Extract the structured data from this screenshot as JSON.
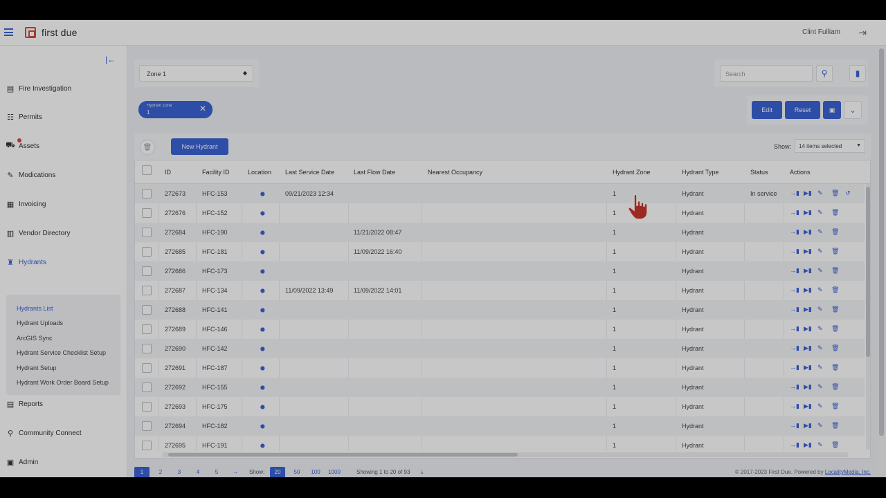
{
  "app": {
    "logo_text": "first due",
    "user_name": "Clint Fulliam"
  },
  "sidebar": {
    "items": [
      {
        "label": "Fire Investigation",
        "icon": "file-icon"
      },
      {
        "label": "Permits",
        "icon": "sliders-icon"
      },
      {
        "label": "Assets",
        "icon": "truck-icon"
      },
      {
        "label": "Modications",
        "icon": "pen-icon"
      },
      {
        "label": "Invoicing",
        "icon": "invoice-icon"
      },
      {
        "label": "Vendor Directory",
        "icon": "book-icon"
      },
      {
        "label": "Hydrants",
        "icon": "hydrant-icon"
      },
      {
        "label": "Reports",
        "icon": "report-icon"
      },
      {
        "label": "Community Connect",
        "icon": "search-icon"
      },
      {
        "label": "Admin",
        "icon": "admin-icon"
      }
    ],
    "subitems": [
      "Hydrants List",
      "Hydrant Uploads",
      "ArcGIS Sync",
      "Hydrant Service Checklist Setup",
      "Hydrant Setup",
      "Hydrant Work Order Board Setup"
    ]
  },
  "filters": {
    "zone_select": "Zone 1",
    "search_placeholder": "Search",
    "chip_label": "Hydrant Zone",
    "chip_value": "1",
    "edit_label": "Edit",
    "reset_label": "Reset"
  },
  "toolbar": {
    "new_button": "New Hydrant",
    "show_label": "Show:",
    "show_value": "14 items selected"
  },
  "table": {
    "columns": [
      "ID",
      "Facility ID",
      "Location",
      "Last Service Date",
      "Last Flow Date",
      "Nearest Occupancy",
      "Hydrant Zone",
      "Hydrant Type",
      "Status",
      "Actions"
    ],
    "rows": [
      {
        "id": "272673",
        "facility": "HFC-153",
        "service": "09/21/2023 12:34",
        "flow": "",
        "zone": "1",
        "type": "Hydrant",
        "status": "In service"
      },
      {
        "id": "272676",
        "facility": "HFC-152",
        "service": "",
        "flow": "",
        "zone": "1",
        "type": "Hydrant",
        "status": ""
      },
      {
        "id": "272684",
        "facility": "HFC-190",
        "service": "",
        "flow": "11/21/2022 08:47",
        "zone": "1",
        "type": "Hydrant",
        "status": ""
      },
      {
        "id": "272685",
        "facility": "HFC-181",
        "service": "",
        "flow": "11/09/2022 16:40",
        "zone": "1",
        "type": "Hydrant",
        "status": ""
      },
      {
        "id": "272686",
        "facility": "HFC-173",
        "service": "",
        "flow": "",
        "zone": "1",
        "type": "Hydrant",
        "status": ""
      },
      {
        "id": "272687",
        "facility": "HFC-134",
        "service": "11/09/2022 13:49",
        "flow": "11/09/2022 14:01",
        "zone": "1",
        "type": "Hydrant",
        "status": ""
      },
      {
        "id": "272688",
        "facility": "HFC-141",
        "service": "",
        "flow": "",
        "zone": "1",
        "type": "Hydrant",
        "status": ""
      },
      {
        "id": "272689",
        "facility": "HFC-146",
        "service": "",
        "flow": "",
        "zone": "1",
        "type": "Hydrant",
        "status": ""
      },
      {
        "id": "272690",
        "facility": "HFC-142",
        "service": "",
        "flow": "",
        "zone": "1",
        "type": "Hydrant",
        "status": ""
      },
      {
        "id": "272691",
        "facility": "HFC-187",
        "service": "",
        "flow": "",
        "zone": "1",
        "type": "Hydrant",
        "status": ""
      },
      {
        "id": "272692",
        "facility": "HFC-155",
        "service": "",
        "flow": "",
        "zone": "1",
        "type": "Hydrant",
        "status": ""
      },
      {
        "id": "272693",
        "facility": "HFC-175",
        "service": "",
        "flow": "",
        "zone": "1",
        "type": "Hydrant",
        "status": ""
      },
      {
        "id": "272694",
        "facility": "HFC-182",
        "service": "",
        "flow": "",
        "zone": "1",
        "type": "Hydrant",
        "status": ""
      },
      {
        "id": "272695",
        "facility": "HFC-191",
        "service": "",
        "flow": "",
        "zone": "1",
        "type": "Hydrant",
        "status": ""
      }
    ]
  },
  "pagination": {
    "pages": [
      "1",
      "2",
      "3",
      "4",
      "5",
      "→"
    ],
    "show_label": "Show:",
    "sizes": [
      "20",
      "50",
      "100",
      "1000"
    ],
    "summary": "Showing 1 to 20 of 93"
  },
  "footer": {
    "copyright": "© 2017-2023 First Due. Powered by",
    "link": "LocalityMedia, Inc."
  },
  "colors": {
    "accent": "#3b63d6",
    "logo": "#d64a3c",
    "cursor": "#c8372c"
  }
}
